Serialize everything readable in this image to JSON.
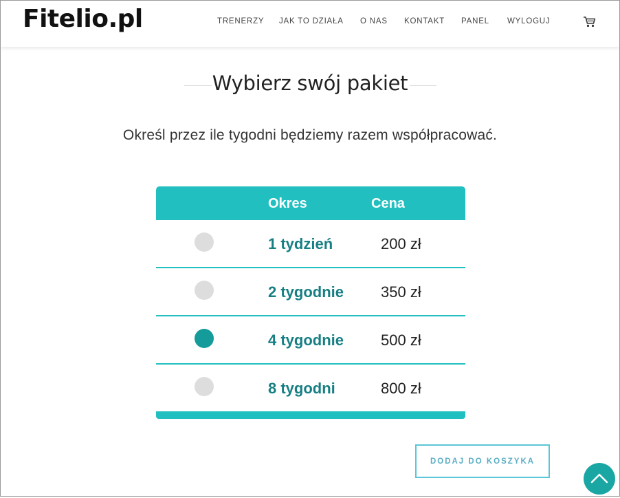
{
  "header": {
    "logo": "Fitelio.pl",
    "nav": [
      {
        "label": "TRENERZY"
      },
      {
        "label": "JAK TO DZIAŁA"
      },
      {
        "label": "O NAS"
      },
      {
        "label": "KONTAKT"
      },
      {
        "label": "PANEL"
      },
      {
        "label": "WYLOGUJ"
      }
    ],
    "cart_icon": "cart-icon"
  },
  "main": {
    "title": "Wybierz swój pakiet",
    "subtitle": "Określ przez ile tygodni będziemy razem współpracować."
  },
  "table": {
    "headers": {
      "period": "Okres",
      "price": "Cena"
    },
    "rows": [
      {
        "period": "1 tydzień",
        "price": "200 zł",
        "selected": false
      },
      {
        "period": "2 tygodnie",
        "price": "350 zł",
        "selected": false
      },
      {
        "period": "4 tygodnie",
        "price": "500 zł",
        "selected": true
      },
      {
        "period": "8 tygodni",
        "price": "800 zł",
        "selected": false
      }
    ]
  },
  "add_to_cart": {
    "label": "DODAJ DO KOSZYKA"
  },
  "scroll_top": {
    "icon": "chevron-up-icon"
  },
  "colors": {
    "accent": "#21bfc0",
    "selected_radio": "#149b9a",
    "unselected_radio": "#dddddd",
    "period_text": "#167f84",
    "button_border": "#5bc6d8"
  }
}
